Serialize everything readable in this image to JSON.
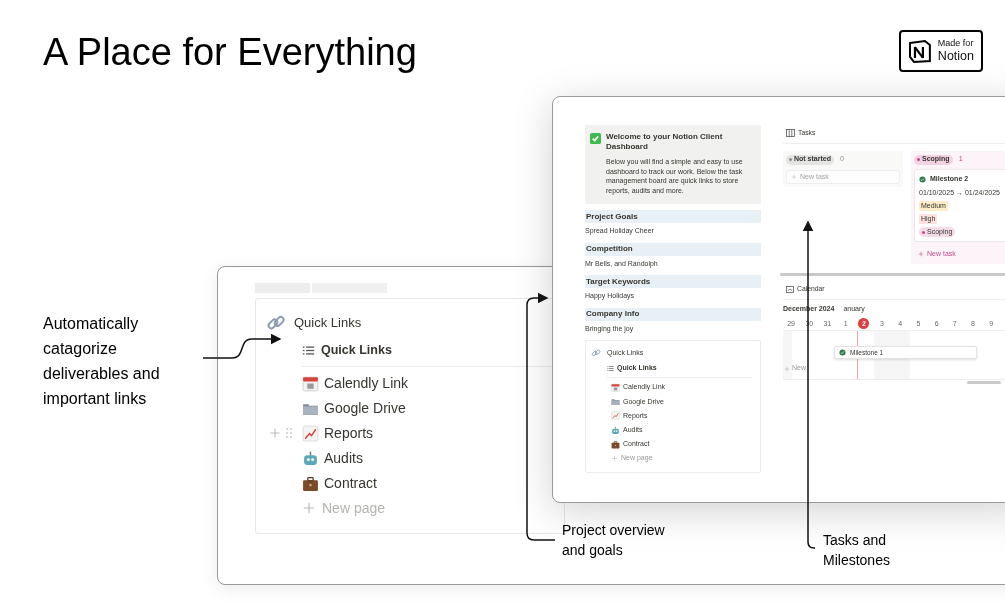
{
  "title": "A Place for Everything",
  "badge": {
    "line1": "Made for",
    "line2": "Notion"
  },
  "annotations": [
    {
      "lines": [
        "Automatically",
        "catagorize",
        "deliverables and",
        "important links"
      ]
    },
    {
      "lines": [
        "Project overview",
        "and goals"
      ]
    },
    {
      "lines": [
        "Tasks and",
        "Milestones"
      ]
    }
  ],
  "quick_links_zoom": {
    "title": "Quick Links",
    "view": "Quick Links",
    "items": [
      {
        "label": "Calendly Link"
      },
      {
        "label": "Google Drive"
      },
      {
        "label": "Reports"
      },
      {
        "label": "Audits"
      },
      {
        "label": "Contract"
      }
    ],
    "new_page": "New page"
  },
  "dashboard": {
    "callout": {
      "title": "Welcome to your Notion Client Dashboard",
      "body": "Below you will find a simple and easy to use dashboard to track our work. Below the task management board are quick links to store reports, audits and more."
    },
    "sections": [
      {
        "heading": "Project Goals",
        "text": "Spread Holiday Cheer"
      },
      {
        "heading": "Competition",
        "text": "Mr Bells, and Randolph"
      },
      {
        "heading": "Target Keywords",
        "text": "Happy Holidays"
      },
      {
        "heading": "Company Info",
        "text": "Bringing the joy"
      }
    ],
    "quick_links": {
      "title": "Quick Links",
      "view": "Quick Links",
      "items": [
        {
          "label": "Calendly Link"
        },
        {
          "label": "Google Drive"
        },
        {
          "label": "Reports"
        },
        {
          "label": "Audits"
        },
        {
          "label": "Contract"
        }
      ],
      "new_page": "New page"
    },
    "tasks": {
      "title": "Tasks",
      "columns": [
        {
          "status": "Not started",
          "count": "0",
          "color": "#91918e",
          "new_task": "New task"
        },
        {
          "status": "Scoping",
          "count": "1",
          "color": "#c14c8a",
          "new_task": "New task",
          "cards": [
            {
              "title": "Milestone 2",
              "dates": "01/10/2025 → 01/24/2025",
              "tags": [
                {
                  "label": "Medium",
                  "color": "#fdecc8"
                },
                {
                  "label": "High",
                  "color": "#ffe2dd"
                }
              ],
              "status": "Scoping"
            }
          ]
        }
      ]
    },
    "calendar": {
      "title": "Calendar",
      "month": "December 2024",
      "next_month": "anuary",
      "days": [
        {
          "label": "29",
          "selected": false
        },
        {
          "label": "30",
          "selected": false
        },
        {
          "label": "31",
          "selected": false
        },
        {
          "label": "1",
          "selected": false
        },
        {
          "label": "2",
          "selected": true
        },
        {
          "label": "3",
          "selected": false
        },
        {
          "label": "4",
          "selected": false
        },
        {
          "label": "5",
          "selected": false
        },
        {
          "label": "6",
          "selected": false
        },
        {
          "label": "7",
          "selected": false
        },
        {
          "label": "8",
          "selected": false
        },
        {
          "label": "9",
          "selected": false
        }
      ],
      "events": [
        {
          "title": "Milestone 1"
        }
      ],
      "new": "New"
    }
  }
}
